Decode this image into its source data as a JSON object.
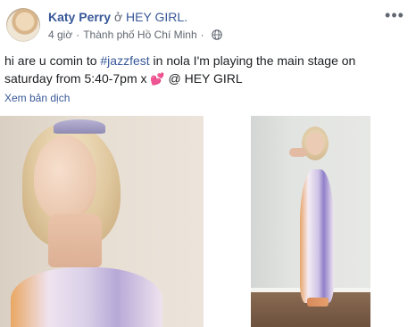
{
  "post": {
    "author": "Katy Perry",
    "connector": "ở",
    "place": "HEY GIRL.",
    "time": "4 giờ",
    "location": "Thành phố Hồ Chí Minh",
    "privacy_icon": "globe-icon",
    "more_icon": "more-options-icon",
    "text_before": "hi are u comin to ",
    "hashtag": "#jazzfest",
    "text_after": " in nola I'm playing the main stage on saturday from 5:40-7pm x ",
    "emoji": "💕",
    "text_end": " @ HEY GIRL",
    "see_translation": "Xem bản dịch"
  },
  "colors": {
    "link": "#385898",
    "meta": "#606770",
    "text": "#1c1e21"
  }
}
